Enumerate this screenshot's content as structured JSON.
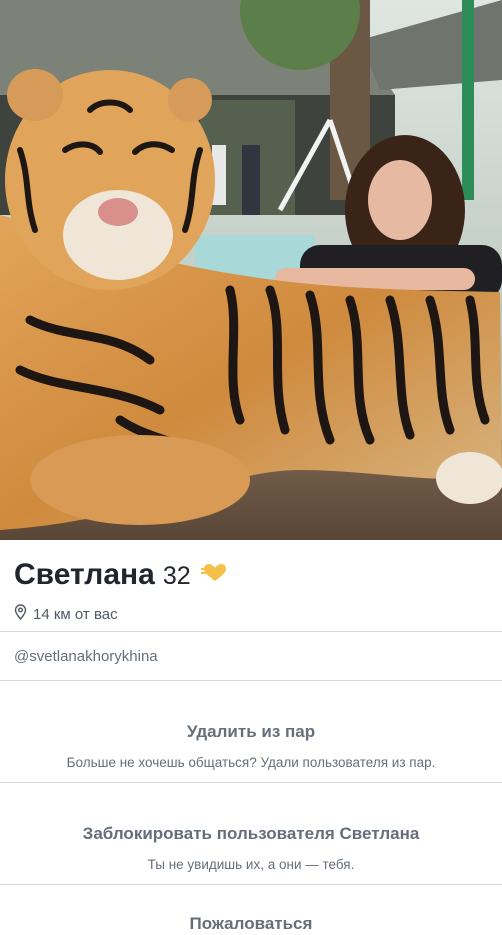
{
  "profile": {
    "name": "Светлана",
    "age": "32",
    "distance": "14 км от вас",
    "username": "@svetlanakhorykhina",
    "photo_description_icon": "profile-photo"
  },
  "actions": {
    "unmatch_title": "Удалить из пар",
    "unmatch_desc": "Больше не хочешь общаться? Удали пользователя из пар.",
    "block_title": "Заблокировать пользователя Светлана",
    "block_desc": "Ты не увидишь их, а они — тебя.",
    "report_title": "Пожаловаться"
  },
  "colors": {
    "badge": "#f5c04a",
    "text_primary": "#21262e",
    "text_secondary": "#656e7b",
    "divider": "#d4d8de"
  }
}
